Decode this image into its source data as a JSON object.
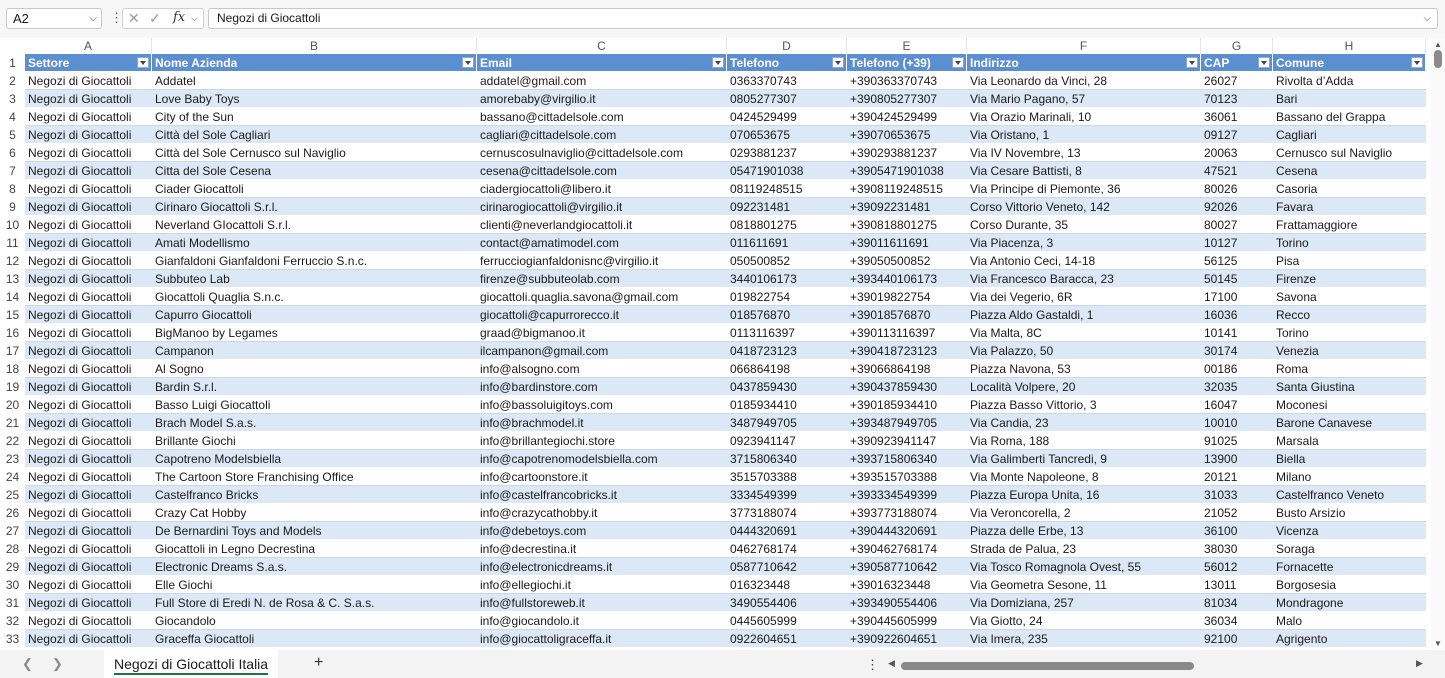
{
  "formula_bar": {
    "name_box": "A2",
    "cancel_icon": "✕",
    "enter_icon": "✓",
    "fx_label": "fx",
    "formula": "Negozi di Giocattoli"
  },
  "columns": [
    "A",
    "B",
    "C",
    "D",
    "E",
    "F",
    "G",
    "H"
  ],
  "table": {
    "headers": [
      "Settore",
      "Nome Azienda",
      "Email",
      "Telefono",
      "Telefono (+39)",
      "Indirizzo",
      "CAP",
      "Comune"
    ],
    "rows": [
      [
        "Negozi di Giocattoli",
        "Addatel",
        "addatel@gmail.com",
        "0363370743",
        "+390363370743",
        "Via Leonardo da Vinci, 28",
        "26027",
        "Rivolta d’Adda"
      ],
      [
        "Negozi di Giocattoli",
        "Love Baby Toys",
        "amorebaby@virgilio.it",
        "0805277307",
        "+390805277307",
        "Via Mario Pagano, 57",
        "70123",
        "Bari"
      ],
      [
        "Negozi di Giocattoli",
        "City of the Sun",
        "bassano@cittadelsole.com",
        "0424529499",
        "+390424529499",
        "Via Orazio Marinali, 10",
        "36061",
        "Bassano del Grappa"
      ],
      [
        "Negozi di Giocattoli",
        "Città del Sole Cagliari",
        "cagliari@cittadelsole.com",
        "070653675",
        "+39070653675",
        "Via Oristano, 1",
        "09127",
        "Cagliari"
      ],
      [
        "Negozi di Giocattoli",
        "Città del Sole Cernusco sul Naviglio",
        "cernuscosulnaviglio@cittadelsole.com",
        "0293881237",
        "+390293881237",
        "Via IV Novembre, 13",
        "20063",
        "Cernusco sul Naviglio"
      ],
      [
        "Negozi di Giocattoli",
        "Citta del Sole Cesena",
        "cesena@cittadelsole.com",
        "05471901038",
        "+3905471901038",
        "Via Cesare Battisti, 8",
        "47521",
        "Cesena"
      ],
      [
        "Negozi di Giocattoli",
        "Ciader Giocattoli",
        "ciadergiocattoli@libero.it",
        "08119248515",
        "+3908119248515",
        "Via Principe di Piemonte, 36",
        "80026",
        "Casoria"
      ],
      [
        "Negozi di Giocattoli",
        "Cirinaro Giocattoli S.r.l.",
        "cirinarogiocattoli@virgilio.it",
        "092231481",
        "+39092231481",
        "Corso Vittorio Veneto, 142",
        "92026",
        "Favara"
      ],
      [
        "Negozi di Giocattoli",
        "Neverland GIocattoli S.r.l.",
        "clienti@neverlandgiocattoli.it",
        "0818801275",
        "+390818801275",
        "Corso Durante, 35",
        "80027",
        "Frattamaggiore"
      ],
      [
        "Negozi di Giocattoli",
        "Amati Modellismo",
        "contact@amatimodel.com",
        "011611691",
        "+39011611691",
        "Via Piacenza, 3",
        "10127",
        "Torino"
      ],
      [
        "Negozi di Giocattoli",
        "Gianfaldoni Gianfaldoni Ferruccio S.n.c.",
        "ferrucciogianfaldonisnc@virgilio.it",
        "050500852",
        "+39050500852",
        "Via Antonio Ceci, 14-18",
        "56125",
        "Pisa"
      ],
      [
        "Negozi di Giocattoli",
        "Subbuteo Lab",
        "firenze@subbuteolab.com",
        "3440106173",
        "+393440106173",
        "Via Francesco Baracca, 23",
        "50145",
        "Firenze"
      ],
      [
        "Negozi di Giocattoli",
        "Giocattoli Quaglia S.n.c.",
        "giocattoli.quaglia.savona@gmail.com",
        "019822754",
        "+39019822754",
        "Via dei Vegerio, 6R",
        "17100",
        "Savona"
      ],
      [
        "Negozi di Giocattoli",
        "Capurro Giocattoli",
        "giocattoli@capurrorecco.it",
        "018576870",
        "+39018576870",
        "Piazza Aldo Gastaldi, 1",
        "16036",
        "Recco"
      ],
      [
        "Negozi di Giocattoli",
        "BigManoo by Legames",
        "graad@bigmanoo.it",
        "0113116397",
        "+390113116397",
        "Via Malta, 8C",
        "10141",
        "Torino"
      ],
      [
        "Negozi di Giocattoli",
        "Campanon",
        "ilcampanon@gmail.com",
        "0418723123",
        "+390418723123",
        "Via Palazzo, 50",
        "30174",
        "Venezia"
      ],
      [
        "Negozi di Giocattoli",
        "Al Sogno",
        "info@alsogno.com",
        "066864198",
        "+39066864198",
        "Piazza Navona, 53",
        "00186",
        "Roma"
      ],
      [
        "Negozi di Giocattoli",
        "Bardin S.r.l.",
        "info@bardinstore.com",
        "0437859430",
        "+390437859430",
        "Località Volpere, 20",
        "32035",
        "Santa Giustina"
      ],
      [
        "Negozi di Giocattoli",
        "Basso Luigi Giocattoli",
        "info@bassoluigitoys.com",
        "0185934410",
        "+390185934410",
        "Piazza Basso Vittorio, 3",
        "16047",
        "Moconesi"
      ],
      [
        "Negozi di Giocattoli",
        "Brach Model S.a.s.",
        "info@brachmodel.it",
        "3487949705",
        "+393487949705",
        "Via Candia, 23",
        "10010",
        "Barone Canavese"
      ],
      [
        "Negozi di Giocattoli",
        "Brillante Giochi",
        "info@brillantegiochi.store",
        "0923941147",
        "+390923941147",
        "Via Roma, 188",
        "91025",
        "Marsala"
      ],
      [
        "Negozi di Giocattoli",
        "Capotreno Modelsbiella",
        "info@capotrenomodelsbiella.com",
        "3715806340",
        "+393715806340",
        "Via Galimberti Tancredi, 9",
        "13900",
        "Biella"
      ],
      [
        "Negozi di Giocattoli",
        "The Cartoon Store Franchising Office",
        "info@cartoonstore.it",
        "3515703388",
        "+393515703388",
        "Via Monte Napoleone, 8",
        "20121",
        "Milano"
      ],
      [
        "Negozi di Giocattoli",
        "Castelfranco Bricks",
        "info@castelfrancobricks.it",
        "3334549399",
        "+393334549399",
        "Piazza Europa Unita, 16",
        "31033",
        "Castelfranco Veneto"
      ],
      [
        "Negozi di Giocattoli",
        "Crazy Cat Hobby",
        "info@crazycathobby.it",
        "3773188074",
        "+393773188074",
        "Via Veroncorella, 2",
        "21052",
        "Busto Arsizio"
      ],
      [
        "Negozi di Giocattoli",
        "De Bernardini Toys and Models",
        "info@debetoys.com",
        "0444320691",
        "+390444320691",
        "Piazza delle Erbe, 13",
        "36100",
        "Vicenza"
      ],
      [
        "Negozi di Giocattoli",
        "Giocattoli in Legno Decrestina",
        "info@decrestina.it",
        "0462768174",
        "+390462768174",
        "Strada de Palua, 23",
        "38030",
        "Soraga"
      ],
      [
        "Negozi di Giocattoli",
        "Electronic Dreams S.a.s.",
        "info@electronicdreams.it",
        "0587710642",
        "+390587710642",
        "Via Tosco Romagnola Ovest, 55",
        "56012",
        "Fornacette"
      ],
      [
        "Negozi di Giocattoli",
        "Elle Giochi",
        "info@ellegiochi.it",
        "016323448",
        "+39016323448",
        "Via Geometra Sesone, 11",
        "13011",
        "Borgosesia"
      ],
      [
        "Negozi di Giocattoli",
        "Full Store di Eredi N. de Rosa & C. S.a.s.",
        "info@fullstoreweb.it",
        "3490554406",
        "+393490554406",
        "Via Domiziana, 257",
        "81034",
        "Mondragone"
      ],
      [
        "Negozi di Giocattoli",
        "Giocandolo",
        "info@giocandolo.it",
        "0445605999",
        "+390445605999",
        "Via Giotto, 24",
        "36034",
        "Malo"
      ],
      [
        "Negozi di Giocattoli",
        "Graceffa Giocattoli",
        "info@giocattoligraceffa.it",
        "0922604651",
        "+390922604651",
        "Via Imera, 235",
        "92100",
        "Agrigento"
      ]
    ]
  },
  "sheet_tabs": {
    "active": "Negozi di Giocattoli Italia",
    "add": "+"
  },
  "colors": {
    "header_bg": "#5b8fcf",
    "band_bg": "#dde8f6",
    "tab_underline": "#1e7145"
  }
}
